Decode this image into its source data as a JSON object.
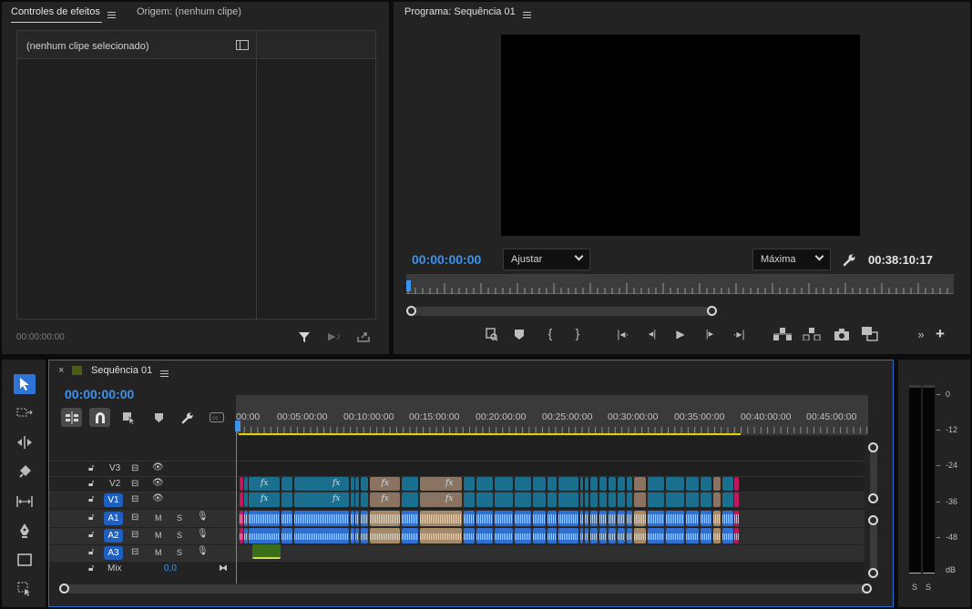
{
  "effects_panel": {
    "tab_effect_controls": "Controles de efeitos",
    "tab_source": "Origem: (nenhum clipe)",
    "no_clip_label": "(nenhum clipe selecionado)",
    "timecode": "00:00:00:00"
  },
  "program_monitor": {
    "title": "Programa: Sequência 01",
    "current_timecode": "00:00:00:00",
    "fit_dropdown": "Ajustar",
    "quality_dropdown": "Máxima",
    "duration_timecode": "00:38:10:17"
  },
  "timeline": {
    "tab_title": "Sequência 01",
    "close_glyph": "×",
    "timecode": "00:00:00:00",
    "ruler_labels": [
      "00:00",
      "00:05:00:00",
      "00:10:00:00",
      "00:15:00:00",
      "00:20:00:00",
      "00:25:00:00",
      "00:30:00:00",
      "00:35:00:00",
      "00:40:00:00",
      "00:45:00:00"
    ],
    "video_tracks": [
      "V3",
      "V2",
      "V1"
    ],
    "audio_tracks": [
      "A1",
      "A2",
      "A3"
    ],
    "mute_label": "M",
    "solo_label": "S",
    "mix_label": "Mix",
    "mix_value": "0,0",
    "fx_label": "fx"
  },
  "audio_meter": {
    "scale": [
      "0",
      "-12",
      "-24",
      "-36",
      "-48",
      "dB"
    ],
    "solo_labels": [
      "S",
      "S"
    ]
  },
  "colors": {
    "accent_blue": "#2d8ceb",
    "video_clip": "#1b6f8e",
    "audio_clip": "#2f6fd1",
    "adjusted_clip": "#8a7461",
    "work_area_bar": "#e6d400"
  },
  "icons": {
    "tools": [
      "selection-tool-icon",
      "track-select-tool-icon",
      "ripple-edit-tool-icon",
      "razor-tool-icon",
      "slip-tool-icon",
      "pen-tool-icon",
      "rectangle-tool-icon",
      "type-tool-icon"
    ],
    "program_transport": [
      "add-marker-icon",
      "mark-in-icon",
      "mark-out-icon",
      "go-to-in-icon",
      "step-back-icon",
      "play-icon",
      "step-forward-icon",
      "go-to-out-icon",
      "lift-icon",
      "extract-icon",
      "export-frame-icon",
      "compare-view-icon",
      "more-icon",
      "add-button-icon"
    ]
  }
}
